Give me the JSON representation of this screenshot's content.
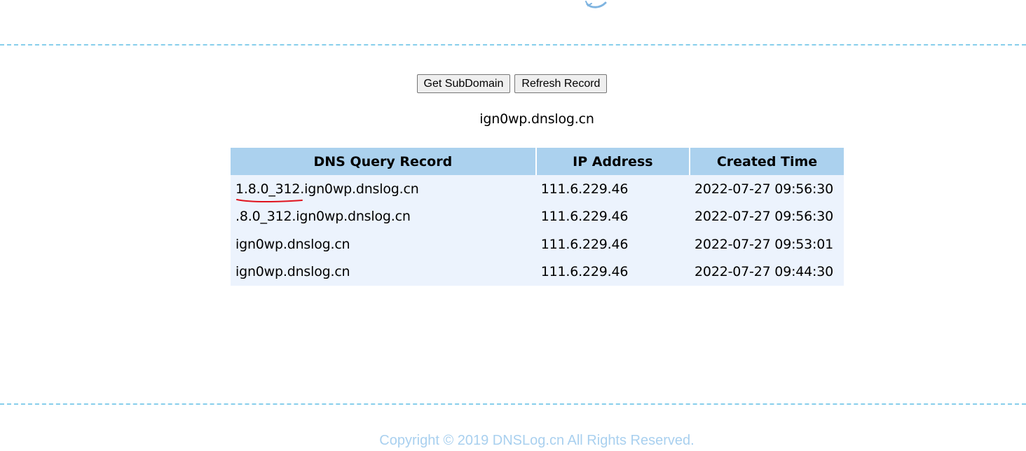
{
  "toolbar": {
    "get_subdomain_label": "Get SubDomain",
    "refresh_record_label": "Refresh Record"
  },
  "subdomain": "ign0wp.dnslog.cn",
  "table": {
    "headers": [
      "DNS Query Record",
      "IP Address",
      "Created Time"
    ],
    "rows": [
      [
        "1.8.0_312.ign0wp.dnslog.cn",
        "111.6.229.46",
        "2022-07-27 09:56:30"
      ],
      [
        ".8.0_312.ign0wp.dnslog.cn",
        "111.6.229.46",
        "2022-07-27 09:56:30"
      ],
      [
        "ign0wp.dnslog.cn",
        "111.6.229.46",
        "2022-07-27 09:53:01"
      ],
      [
        "ign0wp.dnslog.cn",
        "111.6.229.46",
        "2022-07-27 09:44:30"
      ]
    ]
  },
  "footer": {
    "copyright": "Copyright © 2019 DNSLog.cn All Rights Reserved."
  },
  "colors": {
    "header_bg": "#abd1ee",
    "row_bg": "#ecf3fd",
    "divider": "#87ceeb",
    "footer_text": "#a9d0ef",
    "annotation": "#e0141e"
  },
  "icons": {
    "logo": "logo-icon-fragment"
  }
}
